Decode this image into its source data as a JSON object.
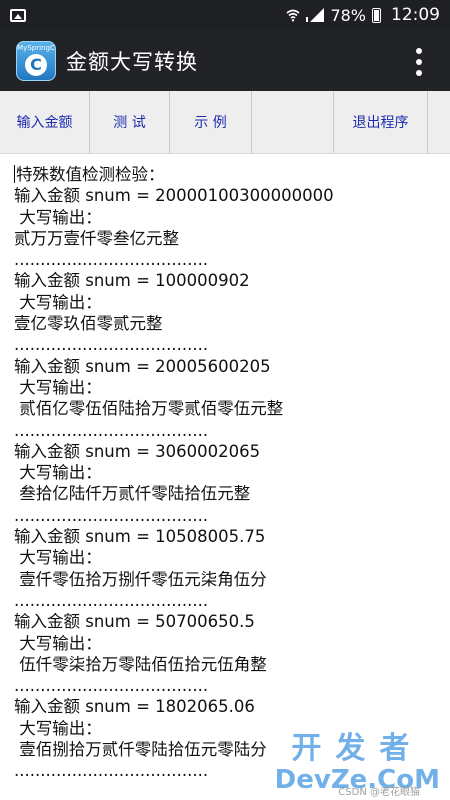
{
  "status": {
    "battery": "78%",
    "time": "12:09"
  },
  "app": {
    "logo_text": "MySpringC",
    "logo_letter": "C",
    "title": "金额大写转换"
  },
  "toolbar": {
    "b1": "输入金额",
    "b2": "测  试",
    "b3": "示  例",
    "b4": "",
    "b5": "退出程序",
    "b6": ""
  },
  "content": {
    "lines": [
      "特殊数值检测检验：",
      "输入金额 snum = 20000100300000000",
      " 大写输出：",
      "贰万万壹仟零叁亿元整",
      ".....................................",
      "输入金额 snum = 100000902",
      " 大写输出：",
      "壹亿零玖佰零贰元整",
      ".....................................",
      "输入金额 snum = 20005600205",
      " 大写输出：",
      " 贰佰亿零伍佰陆拾万零贰佰零伍元整",
      ".....................................",
      "输入金额 snum = 3060002065",
      " 大写输出：",
      " 叁拾亿陆仟万贰仟零陆拾伍元整",
      ".....................................",
      "输入金额 snum = 10508005.75",
      " 大写输出：",
      " 壹仟零伍拾万捌仟零伍元柒角伍分",
      ".....................................",
      "输入金额 snum = 50700650.5",
      " 大写输出：",
      " 伍仟零柒拾万零陆佰伍拾元伍角整",
      ".....................................",
      "输入金额 snum = 1802065.06",
      " 大写输出：",
      " 壹佰捌拾万贰仟零陆拾伍元零陆分",
      "....................................."
    ]
  },
  "watermark": {
    "top": "开发者",
    "bottom": "DevZe.CoM",
    "small": "CSDN @老花眼猫"
  }
}
